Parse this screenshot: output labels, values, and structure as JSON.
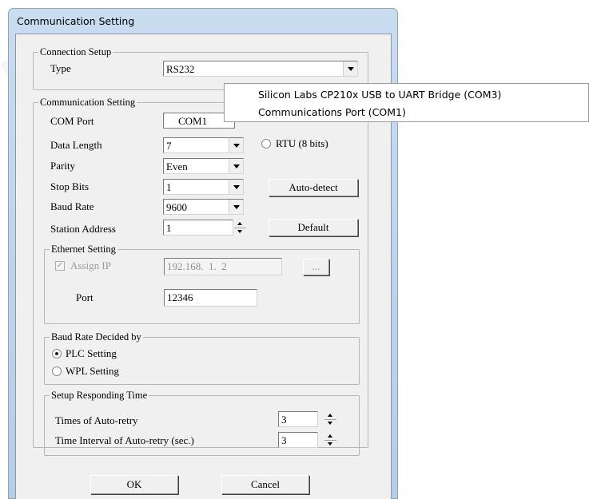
{
  "window": {
    "title": "Communication Setting"
  },
  "connection_setup": {
    "legend": "Connection Setup",
    "type_label": "Type",
    "type_value": "RS232"
  },
  "communication_setting": {
    "legend": "Communication Setting",
    "com_port_label": "COM Port",
    "com_port_value": "COM1",
    "data_length_label": "Data Length",
    "data_length_value": "7",
    "parity_label": "Parity",
    "parity_value": "Even",
    "stop_bits_label": "Stop Bits",
    "stop_bits_value": "1",
    "baud_rate_label": "Baud Rate",
    "baud_rate_value": "9600",
    "station_address_label": "Station Address",
    "station_address_value": "1",
    "rtu_label": "RTU (8 bits)",
    "auto_detect_label": "Auto-detect",
    "default_label": "Default"
  },
  "ethernet_setting": {
    "legend": "Ethernet Setting",
    "assign_ip_label": "Assign IP",
    "ip_value": "192.168.  1.  2",
    "browse_label": "...",
    "port_label": "Port",
    "port_value": "12346"
  },
  "baud_rate_decided": {
    "legend": "Baud Rate Decided by",
    "plc_label": "PLC Setting",
    "wpl_label": "WPL Setting"
  },
  "responding_time": {
    "legend": "Setup Responding Time",
    "retry_label": "Times of Auto-retry",
    "retry_value": "3",
    "interval_label": "Time Interval of Auto-retry (sec.)",
    "interval_value": "3"
  },
  "buttons": {
    "ok": "OK",
    "cancel": "Cancel"
  },
  "com_port_dropdown": {
    "items": [
      "Silicon Labs CP210x USB to UART Bridge (COM3)",
      "Communications Port (COM1)"
    ]
  }
}
